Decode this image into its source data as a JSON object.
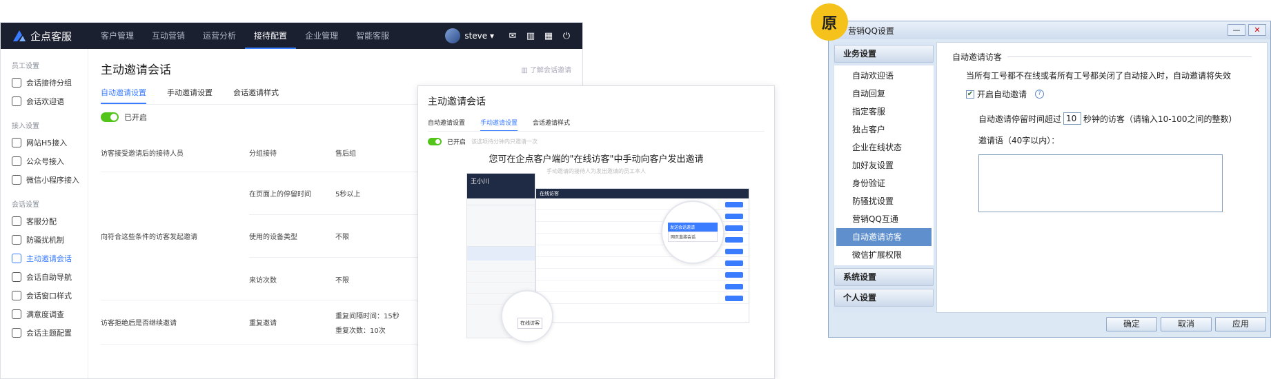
{
  "app": {
    "brand": "企点客服",
    "nav": [
      "客户管理",
      "互动营销",
      "运营分析",
      "接待配置",
      "企业管理",
      "智能客服"
    ],
    "user": "steve ▾",
    "sidebar": [
      {
        "group": "员工设置",
        "items": [
          "会话接待分组",
          "会话欢迎语"
        ]
      },
      {
        "group": "接入设置",
        "items": [
          "网站H5接入",
          "公众号接入",
          "微信小程序接入"
        ]
      },
      {
        "group": "会话设置",
        "items": [
          "客服分配",
          "防骚扰机制",
          "主动邀请会话",
          "会话自助导航",
          "会话窗口样式",
          "满意度调查",
          "会话主题配置"
        ]
      }
    ],
    "page_title": "主动邀请会话",
    "learn_link": "了解会话邀请",
    "tabs": [
      "自动邀请设置",
      "手动邀请设置",
      "会话邀请样式"
    ],
    "toggle_label": "已开启",
    "rows": {
      "r1_label": "访客接受邀请后的接待人员",
      "r1_field": "分组接待",
      "r1_value": "售后组",
      "r2_label": "向符合这些条件的访客发起邀请",
      "r2_sub": [
        {
          "field": "在页面上的停留时间",
          "value": "5秒以上"
        },
        {
          "field": "使用的设备类型",
          "value": "不限"
        },
        {
          "field": "来访次数",
          "value": "不限"
        }
      ],
      "r3_label": "访客拒绝后是否继续邀请",
      "r3_field": "重复邀请",
      "r3_value1": "重复间隔时间：15秒",
      "r3_value2": "重复次数：10次"
    }
  },
  "overlay": {
    "title": "主动邀请会话",
    "tabs": [
      "自动邀请设置",
      "手动邀请设置",
      "会话邀请样式"
    ],
    "toggle_label": "已开启",
    "hint": "该选项待分钟内只邀请一次",
    "headline": "您可在企点客户端的\"在线访客\"中手动向客户发出邀请",
    "subline": "手动邀请的接待人为发出邀请的员工本人",
    "agent_name": "王小川",
    "list_title": "在线访客",
    "popup_items": [
      "发送会话邀请",
      "网页直接会话"
    ],
    "online_visitor": "在线访客"
  },
  "badge": "原",
  "dialog": {
    "title": "营销QQ设置",
    "groups": {
      "business": "业务设置",
      "system": "系统设置",
      "personal": "个人设置"
    },
    "items": [
      "自动欢迎语",
      "自动回复",
      "指定客服",
      "独占客户",
      "企业在线状态",
      "加好友设置",
      "身份验证",
      "防骚扰设置",
      "营销QQ互通",
      "自动邀请访客",
      "微信扩展权限"
    ],
    "selected": "自动邀请访客",
    "section": "自动邀请访客",
    "description": "当所有工号都不在线或者所有工号都关闭了自动接入时，自动邀请将失效",
    "checkbox_label": "开启自动邀请",
    "timeout_prefix": "自动邀请停留时间超过",
    "timeout_value": "10",
    "timeout_suffix": "秒钟的访客（请输入10-100之间的整数）",
    "message_label": "邀请语（40字以内）：",
    "ok": "确定",
    "cancel": "取消",
    "apply": "应用",
    "minimize": "—",
    "close": "✕"
  }
}
